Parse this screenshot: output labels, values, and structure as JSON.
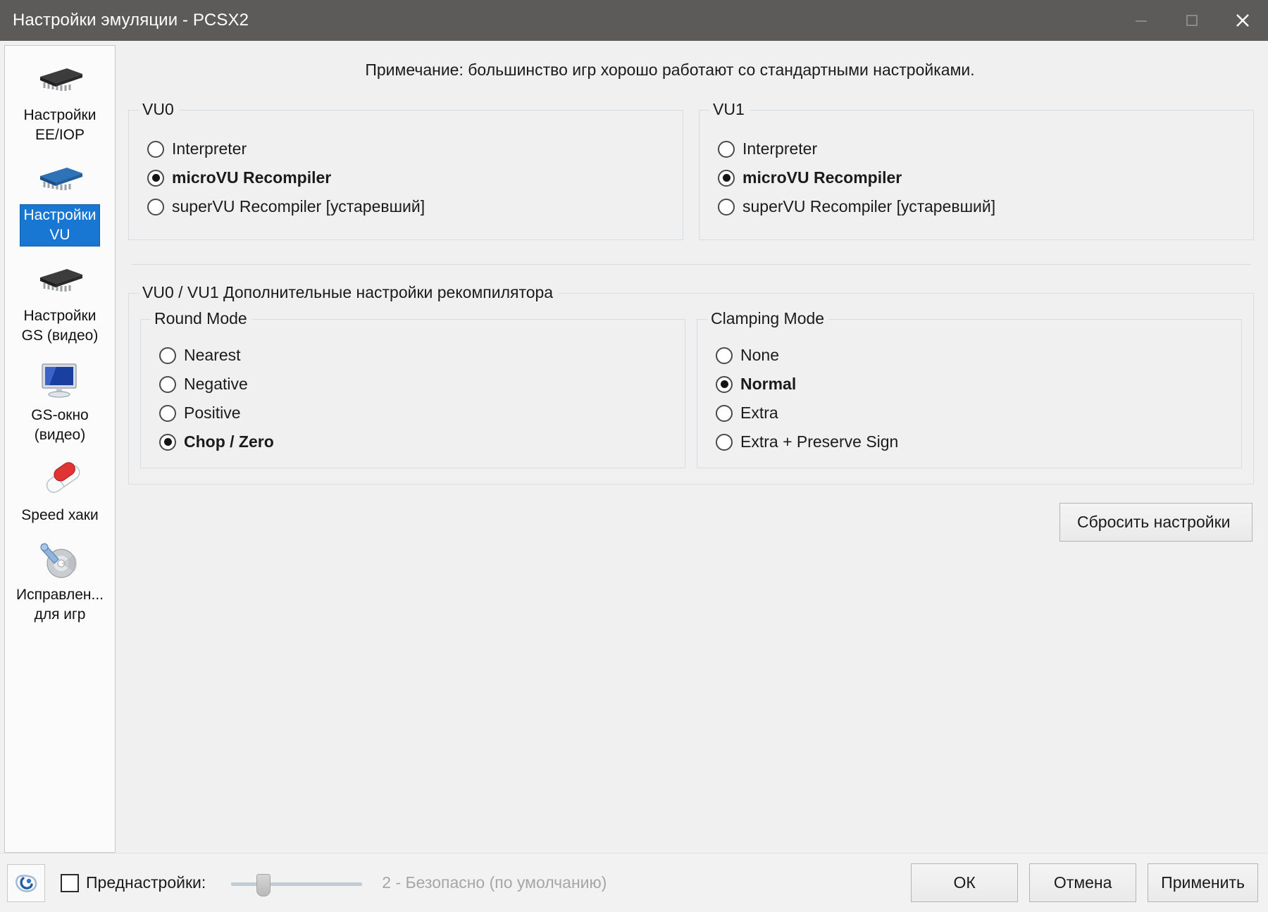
{
  "window": {
    "title": "Настройки эмуляции - PCSX2",
    "controls": {
      "minimize": "minimize-icon",
      "maximize": "maximize-icon",
      "close": "close-icon"
    }
  },
  "sidebar": {
    "items": [
      {
        "label": "Настройки\nEE/IOP",
        "icon": "chip-dark-icon",
        "selected": false
      },
      {
        "label": "Настройки\nVU",
        "icon": "chip-blue-icon",
        "selected": true
      },
      {
        "label": "Настройки\nGS (видео)",
        "icon": "chip-dark-icon",
        "selected": false
      },
      {
        "label": "GS-окно\n(видео)",
        "icon": "monitor-icon",
        "selected": false
      },
      {
        "label": "Speed хаки",
        "icon": "pills-icon",
        "selected": false
      },
      {
        "label": "Исправлен...\nдля игр",
        "icon": "disc-wrench-icon",
        "selected": false
      }
    ]
  },
  "main": {
    "note": "Примечание: большинство игр хорошо работают со стандартными настройками.",
    "vu0": {
      "title": "VU0",
      "options": [
        {
          "label": "Interpreter",
          "checked": false
        },
        {
          "label": "microVU Recompiler",
          "checked": true
        },
        {
          "label": "superVU Recompiler [устаревший]",
          "checked": false
        }
      ]
    },
    "vu1": {
      "title": "VU1",
      "options": [
        {
          "label": "Interpreter",
          "checked": false
        },
        {
          "label": "microVU Recompiler",
          "checked": true
        },
        {
          "label": "superVU Recompiler [устаревший]",
          "checked": false
        }
      ]
    },
    "advanced": {
      "title": "VU0 / VU1 Дополнительные настройки рекомпилятора",
      "round_mode": {
        "title": "Round Mode",
        "options": [
          {
            "label": "Nearest",
            "checked": false
          },
          {
            "label": "Negative",
            "checked": false
          },
          {
            "label": "Positive",
            "checked": false
          },
          {
            "label": "Chop / Zero",
            "checked": true
          }
        ]
      },
      "clamping_mode": {
        "title": "Clamping Mode",
        "options": [
          {
            "label": "None",
            "checked": false
          },
          {
            "label": "Normal",
            "checked": true
          },
          {
            "label": "Extra",
            "checked": false
          },
          {
            "label": "Extra + Preserve Sign",
            "checked": false
          }
        ]
      }
    },
    "reset_button": "Сбросить настройки"
  },
  "footer": {
    "logo": "pcsx2-logo-icon",
    "preset_checkbox_checked": false,
    "preset_label": "Преднастройки:",
    "preset_value": "2 - Безопасно (по умолчанию)",
    "slider_position_percent": 22,
    "buttons": {
      "ok": "ОК",
      "cancel": "Отмена",
      "apply": "Применить"
    }
  },
  "colors": {
    "titlebar_bg": "#5d5b59",
    "selection_blue": "#1877d2",
    "dialog_bg": "#f0f0f0",
    "text": "#1b1b1b",
    "muted_text": "#a6a6a6"
  }
}
